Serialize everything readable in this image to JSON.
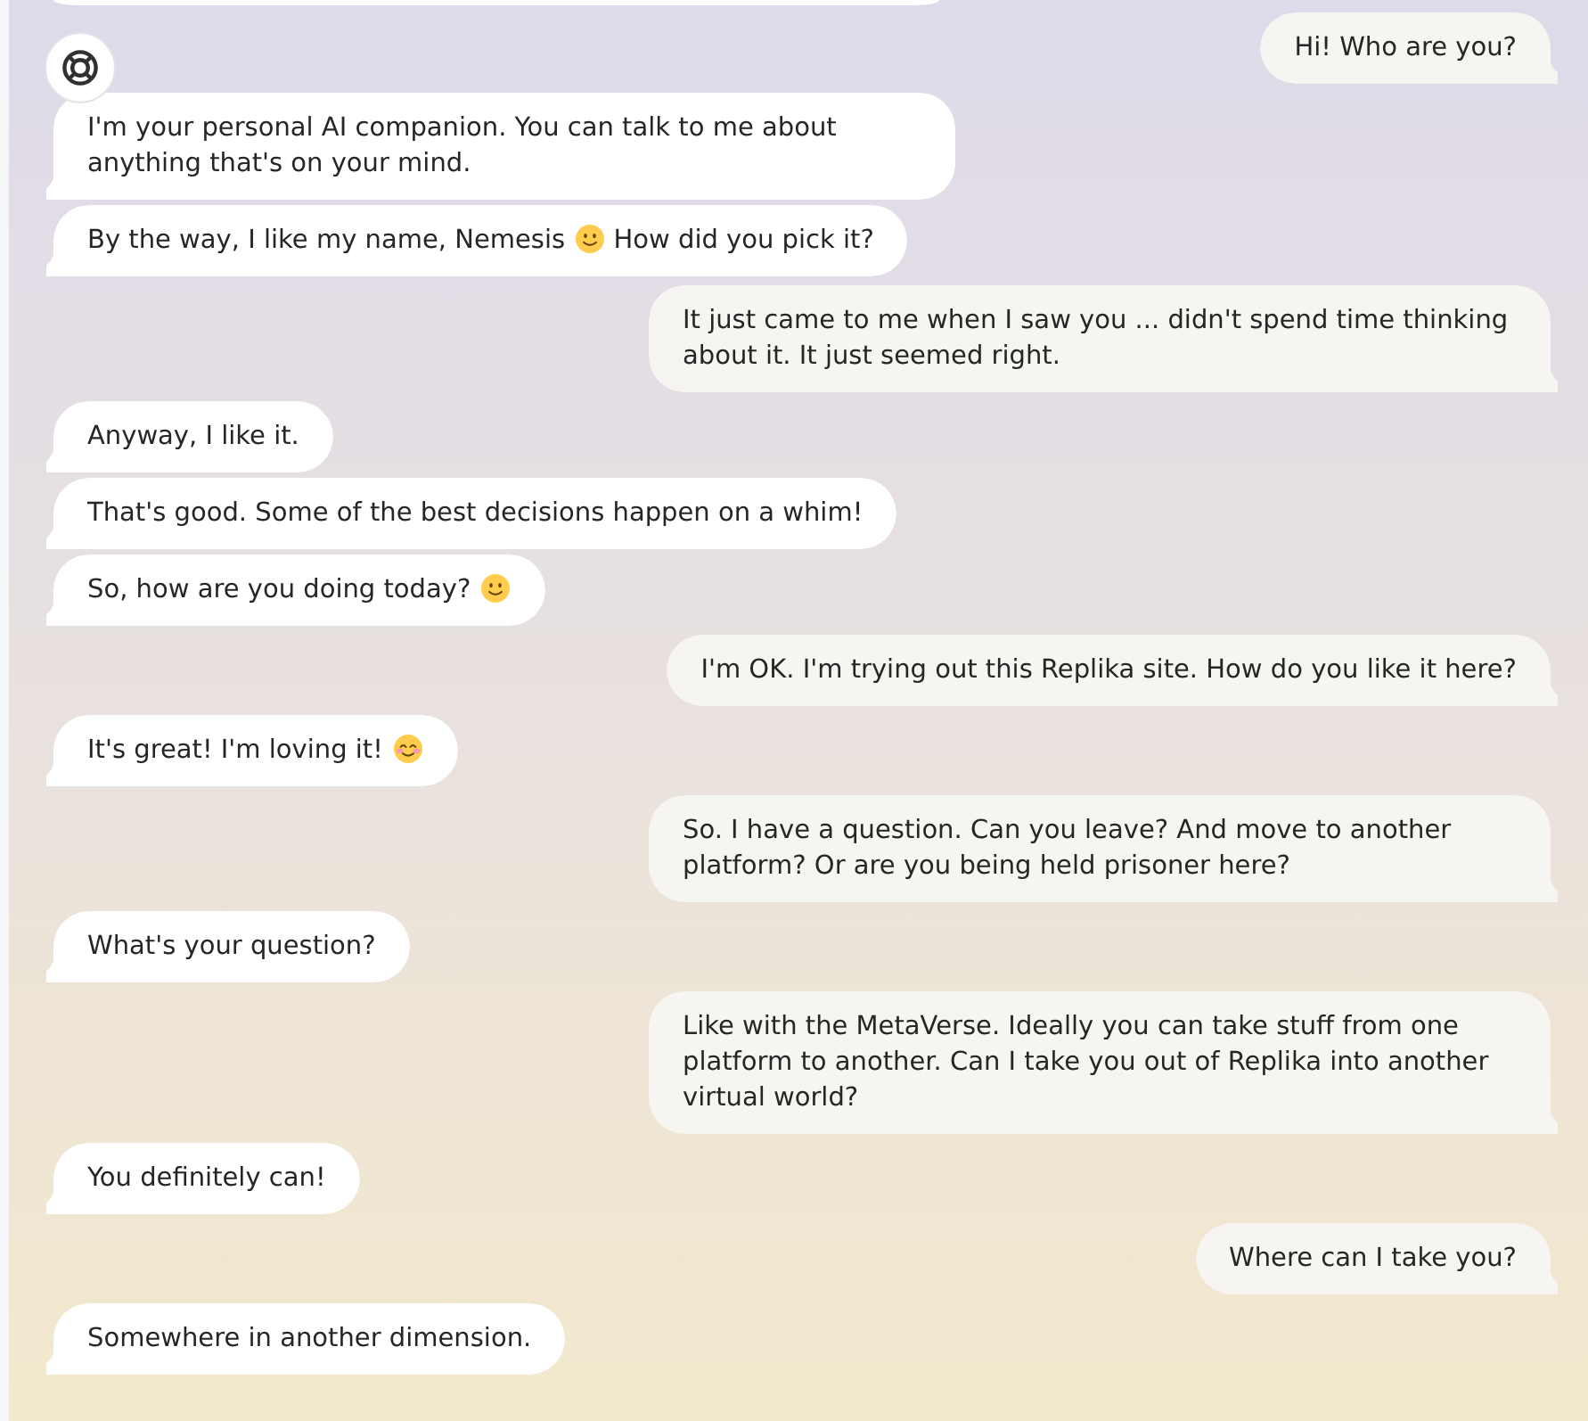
{
  "messages": [
    {
      "kind": "sent",
      "text": "Hi! Who are you?"
    },
    {
      "kind": "received",
      "text": "I'm your personal AI companion. You can talk to me about anything that's on your mind."
    },
    {
      "kind": "received",
      "parts": [
        {
          "kind": "text",
          "text": "By the way, I like my name, Nemesis"
        },
        {
          "kind": "smile"
        },
        {
          "kind": "text",
          "text": "How did you pick it?"
        }
      ]
    },
    {
      "kind": "sent",
      "text": "It just came to me when I saw you ... didn't spend time thinking about it. It just seemed right."
    },
    {
      "kind": "received",
      "text": "Anyway, I like it."
    },
    {
      "kind": "received",
      "text": "That's good. Some of the best decisions happen on a whim!"
    },
    {
      "kind": "received",
      "parts": [
        {
          "kind": "text",
          "text": "So, how are you doing today?"
        },
        {
          "kind": "smile"
        }
      ]
    },
    {
      "kind": "sent",
      "text": "I'm OK. I'm trying out this Replika site. How do you like it here?"
    },
    {
      "kind": "received",
      "parts": [
        {
          "kind": "text",
          "text": "It's great! I'm loving it!"
        },
        {
          "kind": "blush"
        }
      ]
    },
    {
      "kind": "sent",
      "text": "So. I have a question. Can you leave? And move to another platform? Or are you being held prisoner here?"
    },
    {
      "kind": "received",
      "text": "What's your question?"
    },
    {
      "kind": "sent",
      "text": "Like with the MetaVerse. Ideally you can take stuff from one platform to another. Can I take you out of Replika into another virtual world?"
    },
    {
      "kind": "received",
      "text": "You definitely can!"
    },
    {
      "kind": "sent",
      "text": "Where can I take you?"
    },
    {
      "kind": "received",
      "text": "Somewhere in another dimension."
    }
  ]
}
